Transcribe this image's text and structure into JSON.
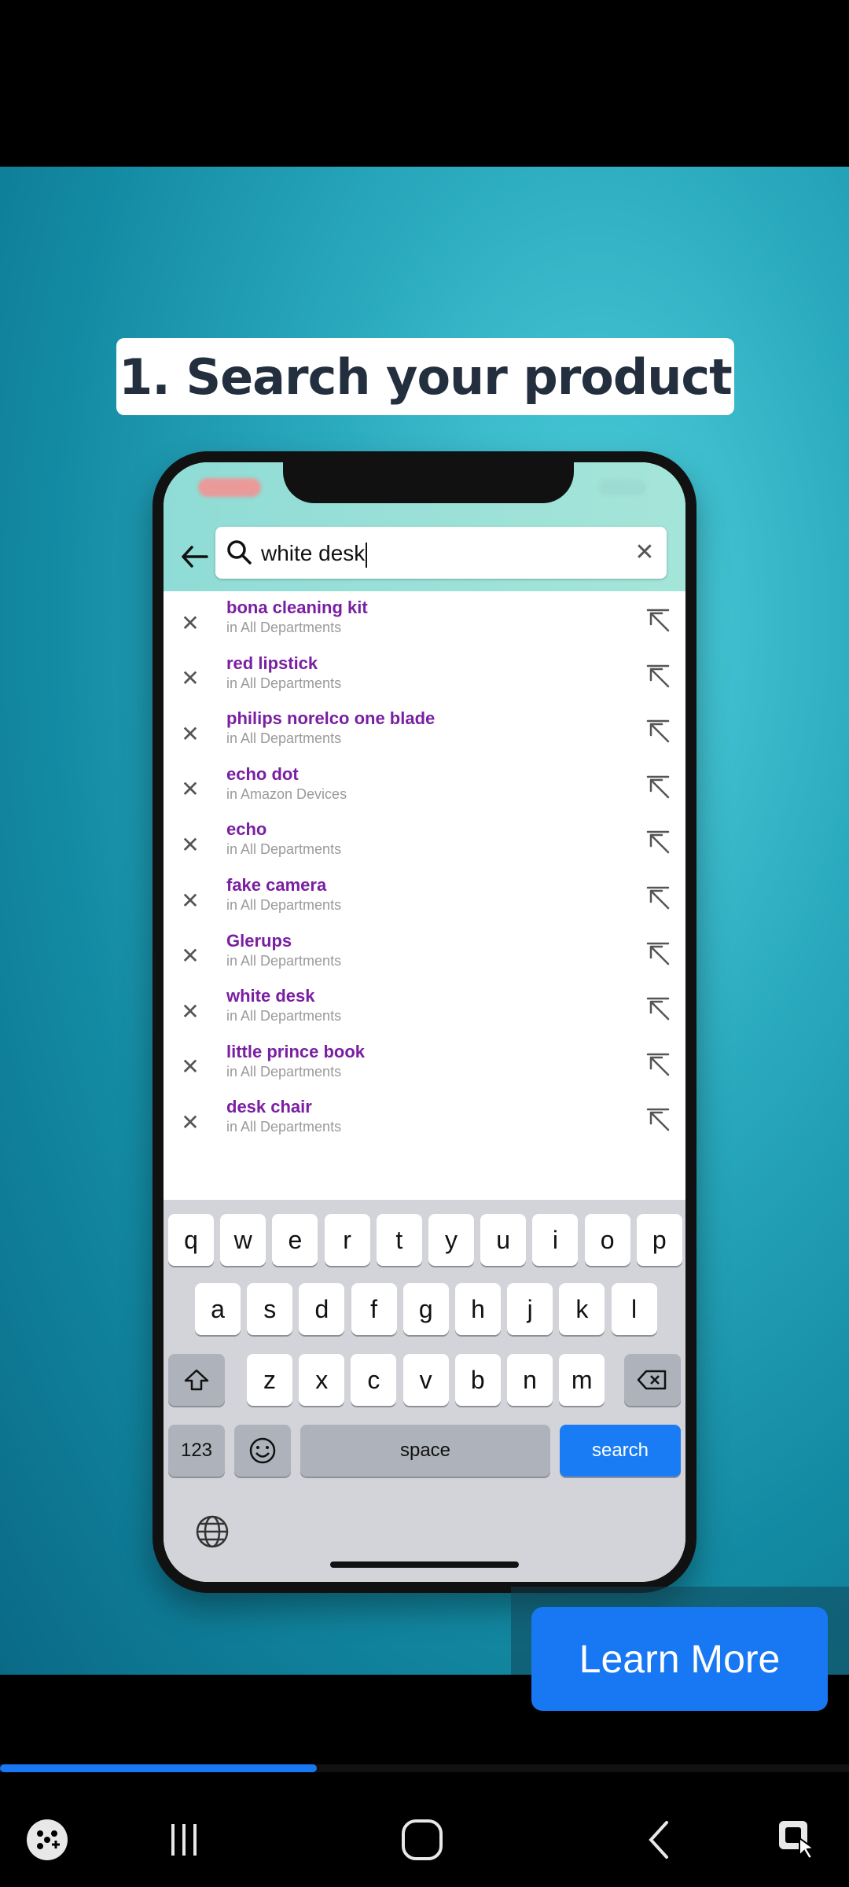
{
  "ad": {
    "headline": "1. Search your product",
    "learn_more": "Learn More",
    "progress": 0.373
  },
  "search": {
    "query": "white desk"
  },
  "suggestions": [
    {
      "title": "bona cleaning kit",
      "dept": "in All Departments"
    },
    {
      "title": "red lipstick",
      "dept": "in All Departments"
    },
    {
      "title": "philips norelco one blade",
      "dept": "in All Departments"
    },
    {
      "title": "echo dot",
      "dept": "in Amazon Devices"
    },
    {
      "title": "echo",
      "dept": "in All Departments"
    },
    {
      "title": "fake camera",
      "dept": "in All Departments"
    },
    {
      "title": "Glerups",
      "dept": "in All Departments"
    },
    {
      "title": "white desk",
      "dept": "in All Departments"
    },
    {
      "title": "little prince book",
      "dept": "in All Departments"
    },
    {
      "title": "desk chair",
      "dept": "in All Departments"
    }
  ],
  "keyboard": {
    "row1": [
      "q",
      "w",
      "e",
      "r",
      "t",
      "y",
      "u",
      "i",
      "o",
      "p"
    ],
    "row2": [
      "a",
      "s",
      "d",
      "f",
      "g",
      "h",
      "j",
      "k",
      "l"
    ],
    "row3": [
      "z",
      "x",
      "c",
      "v",
      "b",
      "n",
      "m"
    ],
    "numbers": "123",
    "space": "space",
    "search": "search"
  },
  "colors": {
    "accent": "#1877f2",
    "suggestion_text": "#7a1fa2"
  },
  "icons": {
    "nav": [
      "game-launcher-icon",
      "recent-apps-icon",
      "home-icon",
      "back-icon",
      "screen-lock-icon"
    ]
  }
}
